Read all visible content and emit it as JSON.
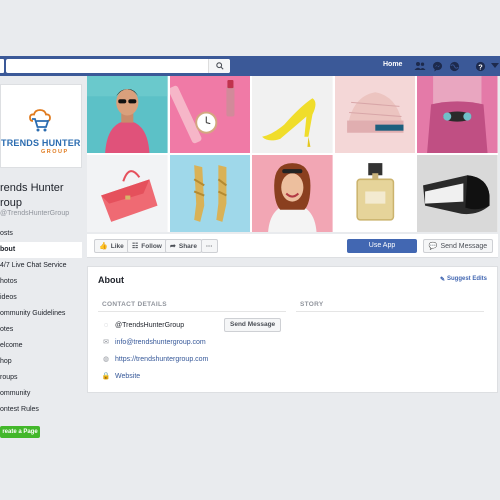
{
  "topbar": {
    "search_placeholder": "",
    "home_label": "Home",
    "icons": [
      "friends-icon",
      "messenger-icon",
      "globe-icon",
      "help-icon",
      "caret-icon"
    ],
    "color": "#3b5998"
  },
  "page": {
    "logo_text_top": "TRENDS HUNTER",
    "logo_text_bottom": "GROUP",
    "name": "rends Hunter roup",
    "name_line1": "rends Hunter",
    "name_line2": "roup",
    "handle": "TrendsHunterGroup"
  },
  "nav": {
    "items": [
      {
        "label": "osts",
        "active": false
      },
      {
        "label": "bout",
        "active": true
      },
      {
        "label": "4/7 Live Chat Service",
        "active": false
      },
      {
        "label": "hotos",
        "active": false
      },
      {
        "label": "ideos",
        "active": false
      },
      {
        "label": "ommunity Guidelines",
        "active": false
      },
      {
        "label": "otes",
        "active": false
      },
      {
        "label": "elcome",
        "active": false
      },
      {
        "label": "hop",
        "active": false
      },
      {
        "label": "roups",
        "active": false
      },
      {
        "label": "ommunity",
        "active": false
      },
      {
        "label": "ontest Rules",
        "active": false
      }
    ],
    "create_page": "reate a Page"
  },
  "cover_tiles": [
    "man-sunglasses",
    "wrist-watch",
    "yellow-heels",
    "knit-hat",
    "woman-pink-top",
    "pink-handbag",
    "gold-sandals",
    "smiling-woman",
    "perfume-bottle",
    "vr-headset"
  ],
  "actions": {
    "like": "Like",
    "follow": "Follow",
    "share": "Share",
    "more": "···",
    "use_app": "Use App",
    "send_message": "Send Message"
  },
  "about": {
    "title": "About",
    "suggest_edits": "Suggest Edits",
    "contact_header": "CONTACT DETAILS",
    "story_header": "STORY",
    "messenger": "@TrendsHunterGroup",
    "send_message": "Send Message",
    "email": "info@trendshuntergroup.com",
    "website_url": "https://trendshuntergroup.com",
    "website_label": "Website"
  }
}
